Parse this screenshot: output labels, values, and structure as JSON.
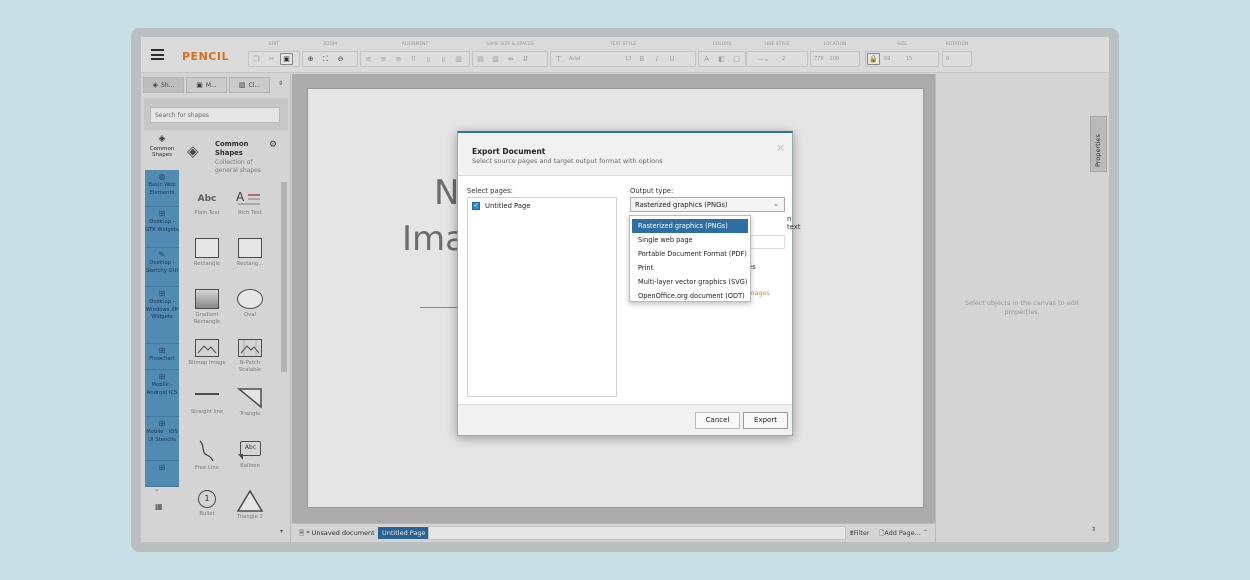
{
  "app": {
    "name": "PENCIL"
  },
  "toolbar": {
    "groups": [
      {
        "label": "EDIT"
      },
      {
        "label": "ZOOM"
      },
      {
        "label": "ALIGNMENT"
      },
      {
        "label": "SAME SIZE & SPACES"
      },
      {
        "label": "TEXT STYLE",
        "font": "Arial",
        "size": "13"
      },
      {
        "label": "COLORS"
      },
      {
        "label": "LINE STYLE",
        "width": "2"
      },
      {
        "label": "LOCATION",
        "x": "778",
        "y": "209"
      },
      {
        "label": "SIZE",
        "w": "59",
        "h": "15"
      },
      {
        "label": "ROTATION",
        "value": "0"
      }
    ]
  },
  "left_tabs": [
    "Sh...",
    "M...",
    "Cl..."
  ],
  "search": {
    "placeholder": "Search for shapes"
  },
  "categories": [
    {
      "label": "Common Shapes"
    },
    {
      "label": "Basic Web Elements"
    },
    {
      "label": "Desktop - GTK Widgets"
    },
    {
      "label": "Desktop - Sketchy GUI"
    },
    {
      "label": "Desktop - Windows XP Widgets"
    },
    {
      "label": "Flowchart"
    },
    {
      "label": "Mobile - Android ICS"
    },
    {
      "label": "Mobile - iOS UI Stencils"
    }
  ],
  "collection": {
    "title": "Common Shapes",
    "subtitle": "Collection of general shapes"
  },
  "shapes": [
    {
      "label": "Plain Text",
      "glyph": "Abc"
    },
    {
      "label": "Rich Text",
      "glyph": "A"
    },
    {
      "label": "Rectangle"
    },
    {
      "label": "Rectang..."
    },
    {
      "label": "Gradient Rectangle"
    },
    {
      "label": "Oval"
    },
    {
      "label": "Bitmap Image"
    },
    {
      "label": "N-Patch Scalable"
    },
    {
      "label": "Straight line"
    },
    {
      "label": "Triangle"
    },
    {
      "label": "Free Line"
    },
    {
      "label": "Balloon",
      "glyph": "Abc"
    },
    {
      "label": "Bullet",
      "glyph": "1"
    },
    {
      "label": "Triangle 2"
    }
  ],
  "canvas": {
    "text_line1": "N",
    "text_line2": "Ima"
  },
  "bottom": {
    "doc": "* Unsaved document",
    "page_tab": "Untitled Page",
    "filter": "Filter",
    "add_page": "Add Page..."
  },
  "properties": {
    "tab": "Properties",
    "hint": "Select objects in the canvas to edit properties."
  },
  "dialog": {
    "title": "Export Document",
    "subtitle": "Select source pages and target output format with options",
    "select_pages_label": "Select pages:",
    "pages": [
      "Untitled Page"
    ],
    "output_type_label": "Output type:",
    "output_type_value": "Rasterized graphics (PNGs)",
    "behind_text_1": "n text",
    "behind_text_2": "es",
    "behind_text_3": "mages",
    "cancel": "Cancel",
    "export": "Export",
    "options": [
      "Rasterized graphics (PNGs)",
      "Single web page",
      "Portable Document Format (PDF)",
      "Print",
      "Multi-layer vector graphics (SVG)",
      "OpenOffice.org document (ODT)"
    ]
  },
  "colors": {
    "accent": "#f07c24",
    "category_blue": "#5b9bc7",
    "select_blue": "#2d6fa5"
  }
}
